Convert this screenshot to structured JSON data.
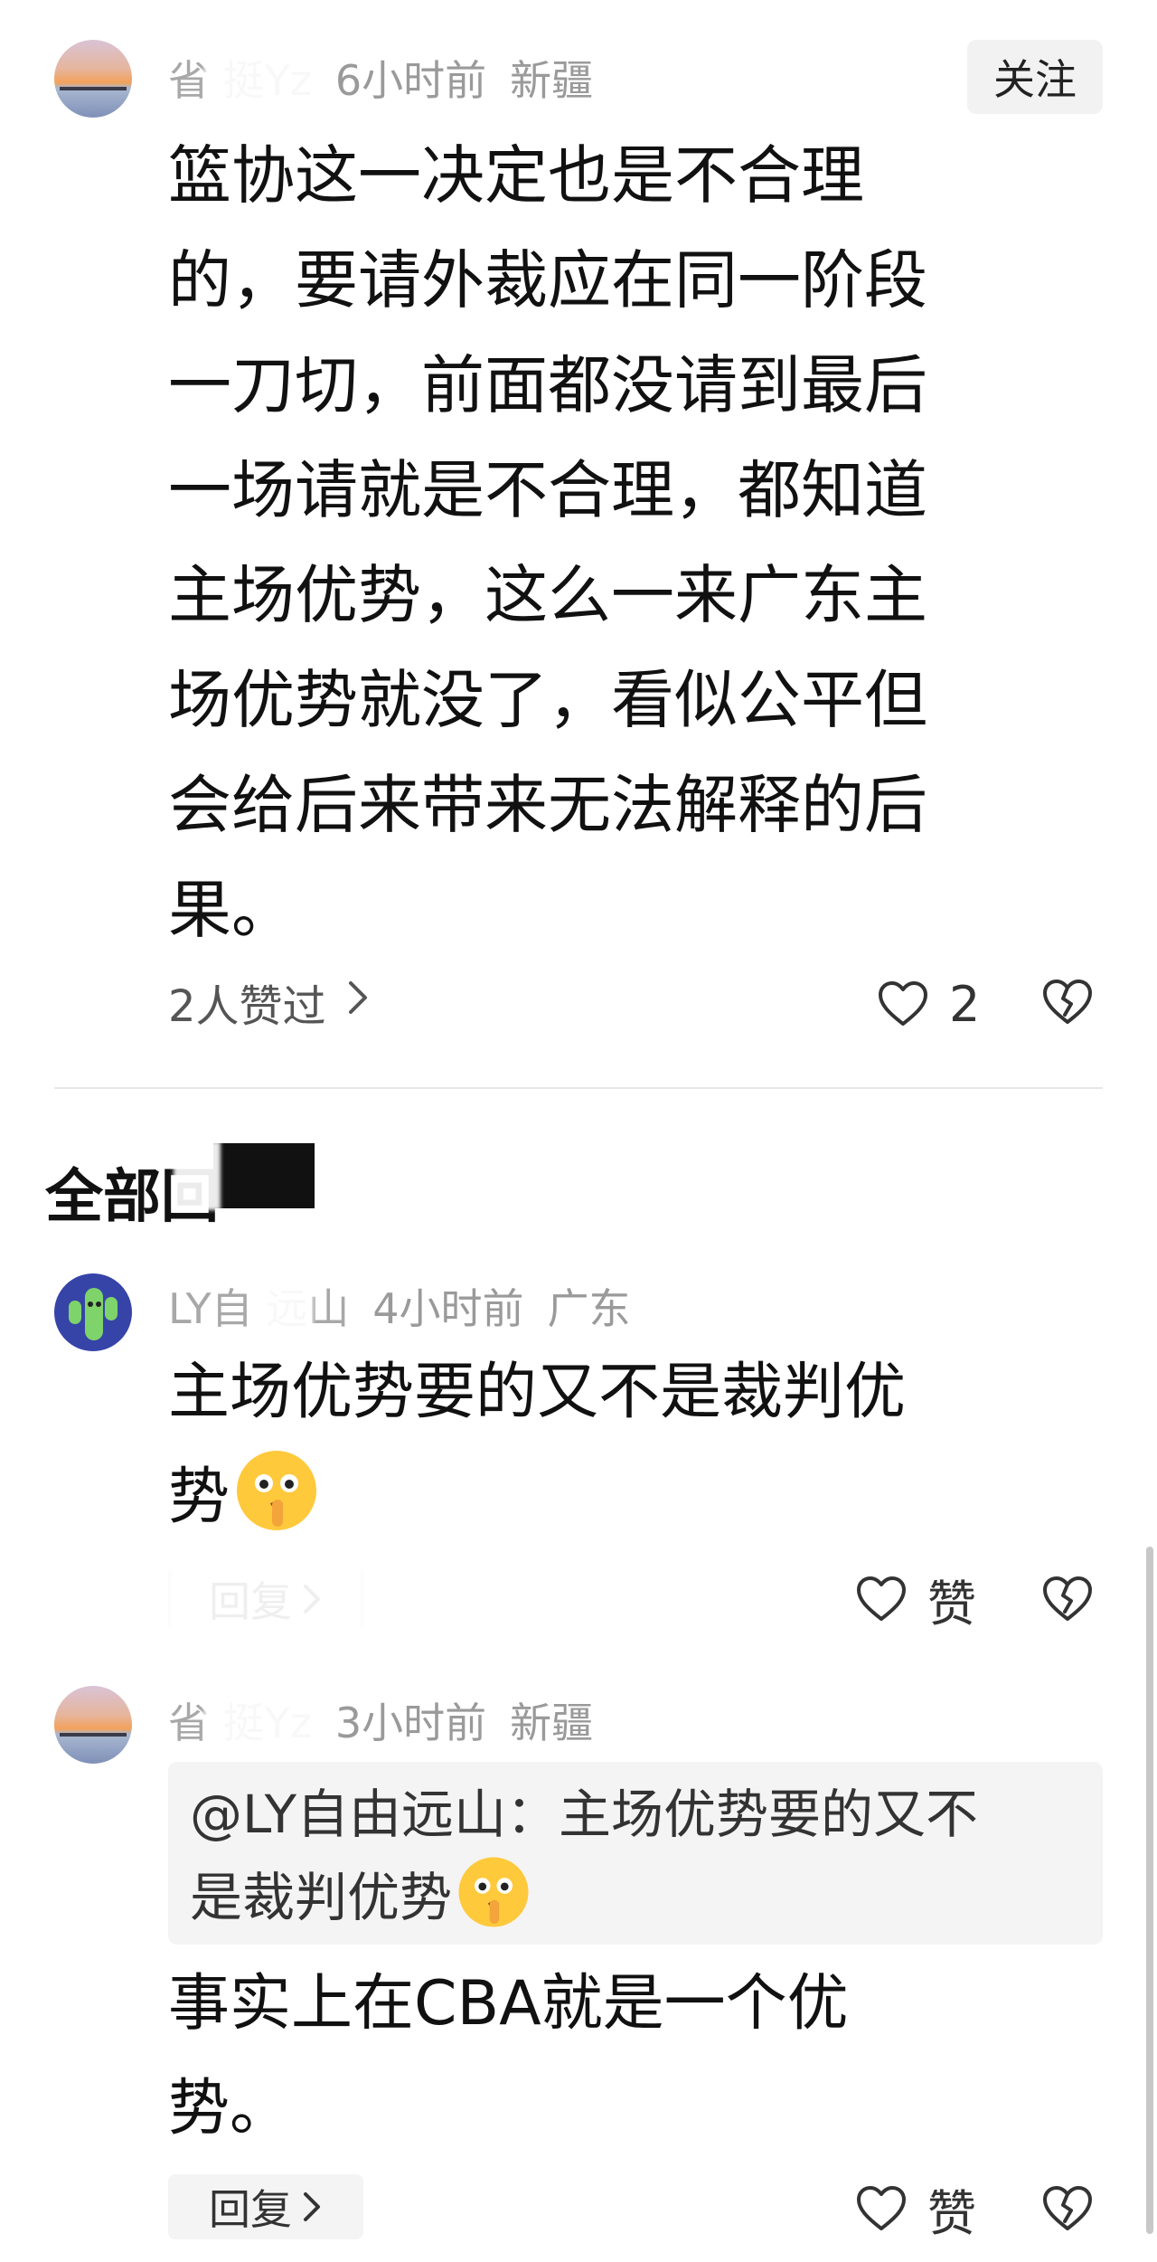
{
  "comment_main": {
    "author": "省  挺Yz",
    "time": "6小时前",
    "location": "新疆",
    "follow_label": "关注",
    "lines": [
      "篮协这一决定也是不合理",
      "的，要请外裁应在同一阶段",
      "一刀切，前面都没请到最后",
      "一场请就是不合理，都知道",
      "主场优势，这么一来广东主",
      "场优势就没了，看似公平但",
      "会给后来带来无法解释的后",
      "果。"
    ],
    "liked_by": "2人赞过",
    "like_count": "2"
  },
  "section": {
    "title": "全部回"
  },
  "replies": [
    {
      "author": "LY自  远山",
      "time": "4小时前",
      "location": "广东",
      "lines": [
        "主场优势要的又不是裁判优",
        "势"
      ],
      "reply_label": "回复",
      "like_label": "赞"
    },
    {
      "author": "省  挺Yz",
      "time": "3小时前",
      "location": "新疆",
      "quote_lines": [
        "@LY自由远山：主场优势要的又不",
        "是裁判优势"
      ],
      "lines": [
        "事实上在CBA就是一个优",
        "势。"
      ],
      "reply_label": "回复",
      "like_label": "赞"
    }
  ],
  "icons": {
    "heart": "heart-outline-icon",
    "dislike": "broken-heart-icon",
    "chevron": "chevron-right-icon",
    "emoji": "shushing-face-emoji"
  },
  "colors": {
    "text": "#111111",
    "meta": "#9a9a9a",
    "chip_bg": "#f4f4f4"
  }
}
